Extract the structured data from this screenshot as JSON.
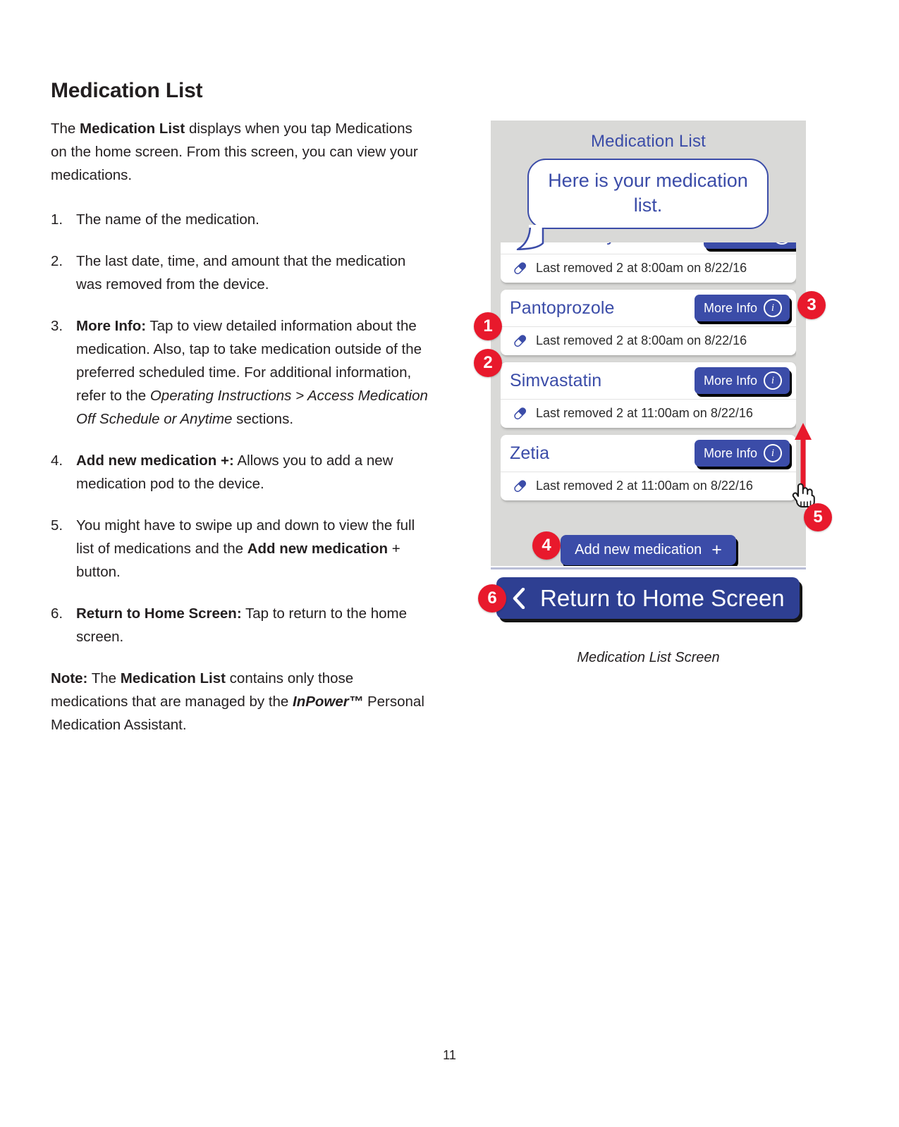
{
  "document": {
    "title": "Medication List",
    "page_number": "11",
    "intro": {
      "prefix": "The ",
      "bold": "Medication List",
      "suffix": " displays when you tap Medications on the home screen. From this screen, you can view your medications."
    },
    "items": [
      {
        "num": "1.",
        "segments": [
          {
            "text": "The name of the medication.",
            "style": "normal"
          }
        ]
      },
      {
        "num": "2.",
        "segments": [
          {
            "text": "The last date, time, and amount that the medication was removed from the device.",
            "style": "normal"
          }
        ]
      },
      {
        "num": "3.",
        "segments": [
          {
            "text": "More Info:",
            "style": "bold"
          },
          {
            "text": " Tap to view detailed information about the medication. Also, tap to take medication outside of the preferred scheduled time. For additional information, refer to the ",
            "style": "normal"
          },
          {
            "text": "Operating Instructions > Access Medication Off Schedule or Anytime",
            "style": "italic"
          },
          {
            "text": " sections.",
            "style": "normal"
          }
        ]
      },
      {
        "num": "4.",
        "segments": [
          {
            "text": "Add new medication +:",
            "style": "bold"
          },
          {
            "text": " Allows you to add a new medication pod to the device.",
            "style": "normal"
          }
        ]
      },
      {
        "num": "5.",
        "segments": [
          {
            "text": "You might have to swipe up and down to view the full list of medications and the ",
            "style": "normal"
          },
          {
            "text": "Add new medication",
            "style": "bold"
          },
          {
            "text": " + button.",
            "style": "normal"
          }
        ]
      },
      {
        "num": "6.",
        "segments": [
          {
            "text": "Return to Home Screen:",
            "style": "bold"
          },
          {
            "text": " Tap to return to the home screen.",
            "style": "normal"
          }
        ]
      }
    ],
    "note": {
      "segments": [
        {
          "text": "Note:",
          "style": "bold"
        },
        {
          "text": " The ",
          "style": "normal"
        },
        {
          "text": "Medication List",
          "style": "bold"
        },
        {
          "text": " contains only those medications that are managed by the ",
          "style": "normal"
        },
        {
          "text": "InPower™",
          "style": "bold-italic"
        },
        {
          "text": " Personal Medication Assistant.",
          "style": "normal"
        }
      ]
    },
    "figure_caption": "Medication List Screen"
  },
  "device": {
    "screen_title": "Medication List",
    "assistant_bubble": "Here is your medication list.",
    "medications": [
      {
        "name": "Metformin Hydrochloride",
        "more_info_label": "More Info",
        "last_removed": "Last removed 2 at 8:00am on 8/22/16",
        "clipped": true
      },
      {
        "name": "Pantoprozole",
        "more_info_label": "More Info",
        "last_removed": "Last removed 2 at 8:00am on 8/22/16",
        "clipped": false
      },
      {
        "name": "Simvastatin",
        "more_info_label": "More Info",
        "last_removed": "Last removed 2 at 11:00am on 8/22/16",
        "clipped": false
      },
      {
        "name": "Zetia",
        "more_info_label": "More Info",
        "last_removed": "Last removed 2 at 11:00am on 8/22/16",
        "clipped": false
      }
    ],
    "add_medication_label": "Add new medication",
    "add_medication_plus": "+",
    "return_home_label": "Return to Home Screen"
  },
  "callouts": [
    {
      "id": "1",
      "label": "1"
    },
    {
      "id": "2",
      "label": "2"
    },
    {
      "id": "3",
      "label": "3"
    },
    {
      "id": "4",
      "label": "4"
    },
    {
      "id": "5",
      "label": "5"
    },
    {
      "id": "6",
      "label": "6"
    }
  ],
  "colors": {
    "brand_blue": "#3b4ca8",
    "deep_blue": "#2e3f92",
    "callout_red": "#e8192c",
    "screen_grey": "#d9d9d7",
    "ink": "#231f20"
  }
}
